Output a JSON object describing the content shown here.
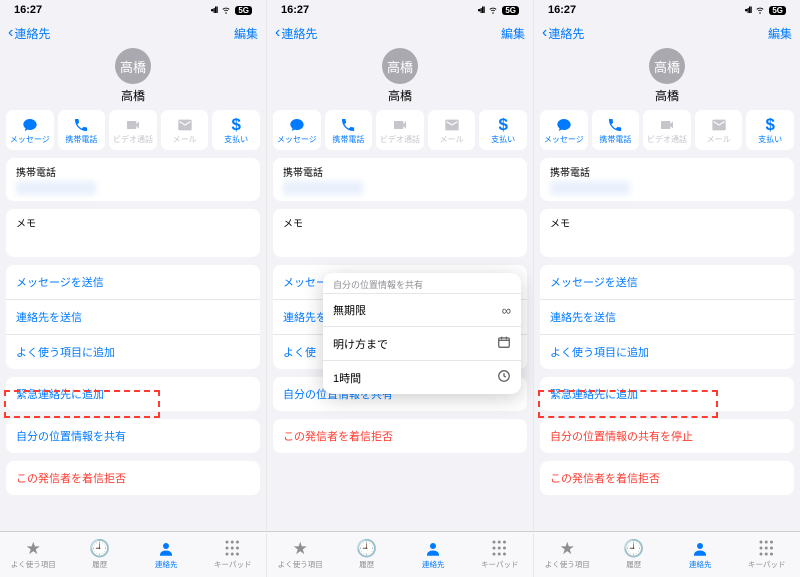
{
  "status": {
    "time": "16:27",
    "cell": "5G"
  },
  "nav": {
    "back": "連絡先",
    "edit": "編集"
  },
  "contact": {
    "avatarText": "高橋",
    "name": "高橋"
  },
  "actions": {
    "message": "メッセージ",
    "phone": "携帯電話",
    "video": "ビデオ通話",
    "mail": "メール",
    "pay": "支払い"
  },
  "fields": {
    "phoneLabel": "携帯電話",
    "memoLabel": "メモ"
  },
  "menu": {
    "sendMessage": "メッセージを送信",
    "sendContact": "連絡先を送信",
    "addFavShort": "よく使",
    "addFav": "よく使う項目に追加",
    "addEmergency": "緊急連絡先に追加",
    "shareLocation": "自分の位置情報を共有",
    "stopShareLocation": "自分の位置情報の共有を停止",
    "blockCaller": "この発信者を着信拒否"
  },
  "popover": {
    "title": "自分の位置情報を共有",
    "opt1": "無期限",
    "opt2": "明け方まで",
    "opt3": "1時間"
  },
  "tabs": {
    "fav": "よく使う項目",
    "history": "履歴",
    "contacts": "連絡先",
    "keypad": "キーパッド"
  }
}
